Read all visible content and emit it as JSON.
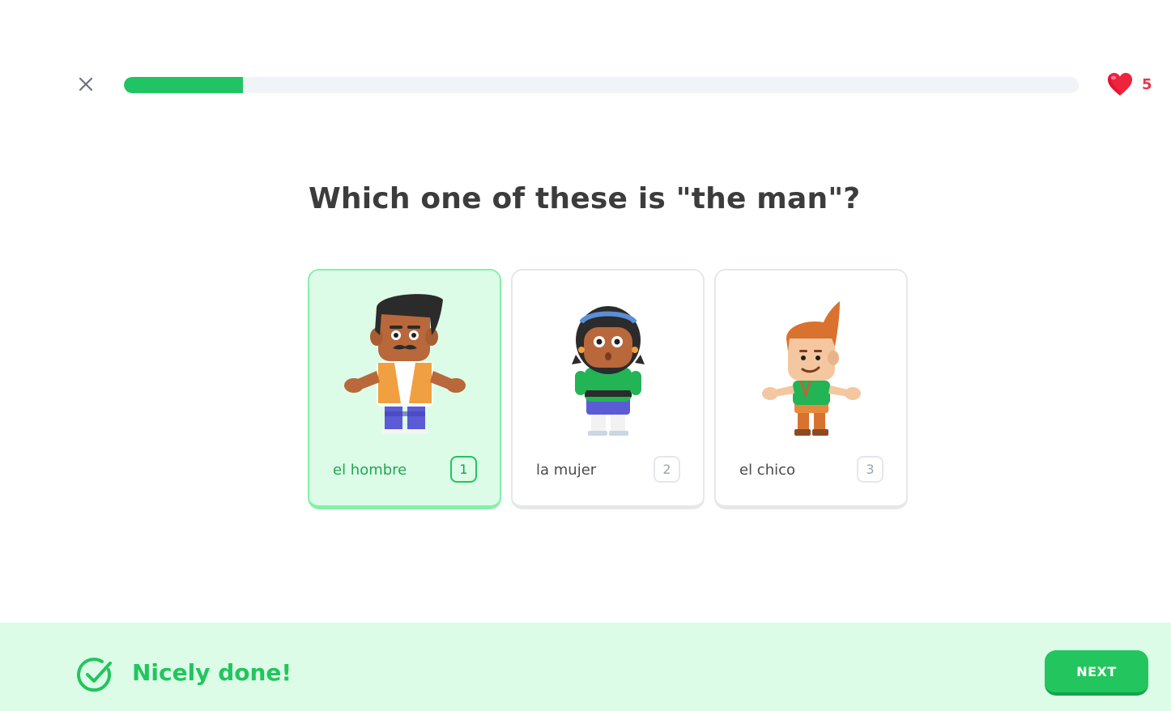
{
  "header": {
    "close_icon": "close-icon",
    "progress": 0.125,
    "progress_color": "#21c464",
    "hearts": {
      "icon": "heart-icon",
      "count": "5",
      "color": "#e8354b"
    }
  },
  "question": {
    "text": "Which one of these is \"the man\"?"
  },
  "options": [
    {
      "label": "el hombre",
      "key": "1",
      "selected": true,
      "image": "man-illustration"
    },
    {
      "label": "la mujer",
      "key": "2",
      "selected": false,
      "image": "woman-illustration"
    },
    {
      "label": "el chico",
      "key": "3",
      "selected": false,
      "image": "boy-illustration"
    }
  ],
  "footer": {
    "icon": "check-circle-icon",
    "message": "Nicely done!",
    "next_label": "NEXT",
    "accent": "#22c55e",
    "background": "#dcfce7"
  }
}
